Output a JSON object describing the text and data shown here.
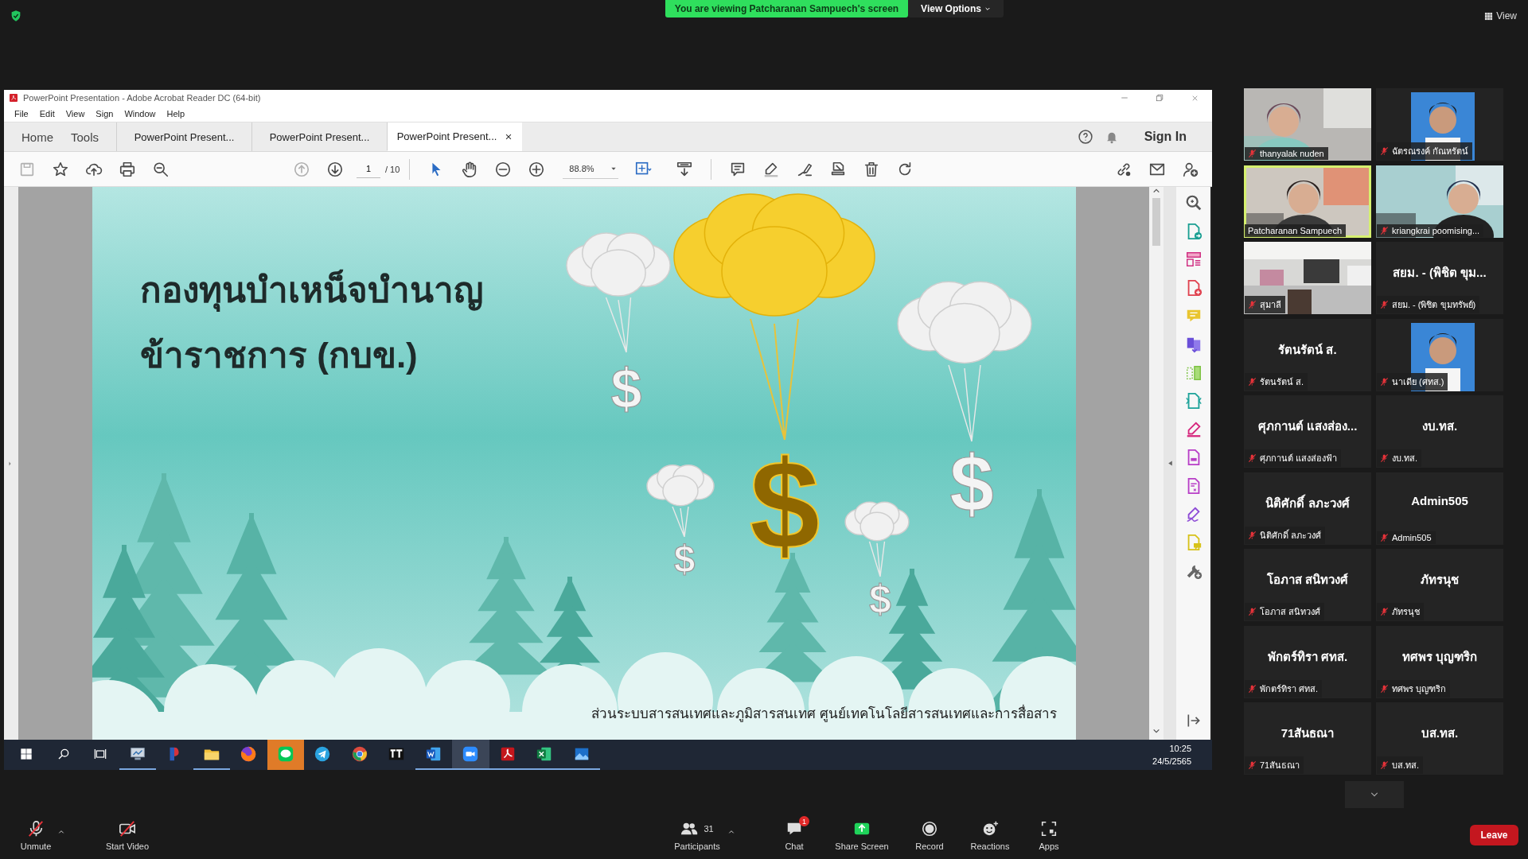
{
  "top_bar": {
    "banner": "You are viewing Patcharanan Sampuech's screen",
    "view_options": "View Options",
    "view": "View"
  },
  "shared_screen": {
    "title": "PowerPoint Presentation - Adobe Acrobat Reader DC (64-bit)",
    "menu": [
      "File",
      "Edit",
      "View",
      "Sign",
      "Window",
      "Help"
    ],
    "nav": [
      "Home",
      "Tools"
    ],
    "tabs": [
      {
        "label": "PowerPoint Present...",
        "selected": false
      },
      {
        "label": "PowerPoint Present...",
        "selected": false
      },
      {
        "label": "PowerPoint Present...",
        "selected": true
      }
    ],
    "sign_in": "Sign In",
    "toolbar": {
      "page": "1",
      "page_count": "/ 10",
      "zoom": "88.8%"
    },
    "slide": {
      "title": [
        "กองทุนบำเหน็จบำนาญ",
        "ข้าราชการ (กบข.)"
      ],
      "dollar_signs": [
        "$",
        "$",
        "$",
        "$",
        "$"
      ],
      "footer": "ส่วนระบบสารสนเทศและภูมิสารสนเทศ ศูนย์เทคโนโลยีสารสนเทศและการสื่อสาร"
    },
    "taskbar": {
      "apps": [
        {
          "open": true,
          "attention": false,
          "selected": false
        },
        {
          "open": false,
          "attention": false,
          "selected": false
        },
        {
          "open": true,
          "attention": false,
          "selected": false
        },
        {
          "open": false,
          "attention": false,
          "selected": false
        },
        {
          "open": false,
          "attention": true,
          "selected": false
        },
        {
          "open": false,
          "attention": false,
          "selected": false
        },
        {
          "open": false,
          "attention": false,
          "selected": false
        },
        {
          "open": false,
          "attention": false,
          "selected": false
        },
        {
          "open": true,
          "attention": false,
          "selected": false
        },
        {
          "open": true,
          "attention": false,
          "selected": true
        },
        {
          "open": true,
          "attention": false,
          "selected": false
        },
        {
          "open": true,
          "attention": false,
          "selected": false
        },
        {
          "open": true,
          "attention": false,
          "selected": false
        }
      ],
      "time": "10:25",
      "date": "24/5/2565"
    }
  },
  "participants": [
    {
      "label": "thanyalak nuden",
      "video": true,
      "muted": true,
      "active_speaker": false
    },
    {
      "label": "ฉัตรณรงค์ กัณหรัตน์",
      "video": true,
      "muted": true,
      "active_speaker": false
    },
    {
      "label": "Patcharanan Sampuech",
      "video": true,
      "muted": false,
      "active_speaker": true
    },
    {
      "label": "kriangkrai poomising...",
      "video": true,
      "muted": true,
      "active_speaker": false
    },
    {
      "label": "สุมาลี",
      "video": true,
      "muted": true,
      "active_speaker": false
    },
    {
      "display": "สยม. - (พิชิต ขุม...",
      "label": "สยม. - (พิชิต ขุมทรัพย์)",
      "video": false,
      "muted": true,
      "active_speaker": false
    },
    {
      "display": "รัตนรัตน์ ส.",
      "label": "รัตนรัตน์ ส.",
      "video": false,
      "muted": true,
      "active_speaker": false
    },
    {
      "label": "นาเดีย (ศทส.)",
      "video": true,
      "muted": true,
      "active_speaker": false
    },
    {
      "display": "ศุภกานต์ แสงส่อง...",
      "label": "ศุภกานต์ แสงส่องฟ้า",
      "video": false,
      "muted": true,
      "active_speaker": false
    },
    {
      "display": "งบ.ทส.",
      "label": "งบ.ทส.",
      "video": false,
      "muted": true,
      "active_speaker": false
    },
    {
      "display": "นิติศักดิ์ ลภะวงศ์",
      "label": "นิติศักดิ์ ลภะวงศ์",
      "video": false,
      "muted": true,
      "active_speaker": false
    },
    {
      "display": "Admin505",
      "label": "Admin505",
      "video": false,
      "muted": true,
      "active_speaker": false
    },
    {
      "display": "โอภาส สนิทวงศ์",
      "label": "โอภาส สนิทวงศ์",
      "video": false,
      "muted": true,
      "active_speaker": false
    },
    {
      "display": "ภัทรนุช",
      "label": "ภัทรนุช",
      "video": false,
      "muted": true,
      "active_speaker": false
    },
    {
      "display": "พักตร์ทิรา ศทส.",
      "label": "พักตร์ทิรา ศทส.",
      "video": false,
      "muted": true,
      "active_speaker": false
    },
    {
      "display": "ทศพร บุญฑริก",
      "label": "ทศพร บุญฑริก",
      "video": false,
      "muted": true,
      "active_speaker": false
    },
    {
      "display": "71สันธณา",
      "label": "71สันธณา",
      "video": false,
      "muted": true,
      "active_speaker": false
    },
    {
      "display": "บส.ทส.",
      "label": "บส.ทส.",
      "video": false,
      "muted": true,
      "active_speaker": false
    }
  ],
  "controls": [
    {
      "kind": "mic",
      "label": "Unmute"
    },
    {
      "kind": "video",
      "label": "Start Video"
    },
    {
      "kind": "participants",
      "label": "Participants",
      "count": "31"
    },
    {
      "kind": "chat",
      "label": "Chat",
      "badge": "1"
    },
    {
      "kind": "share",
      "label": "Share Screen"
    },
    {
      "kind": "record",
      "label": "Record"
    },
    {
      "kind": "reactions",
      "label": "Reactions"
    },
    {
      "kind": "apps",
      "label": "Apps"
    }
  ],
  "leave": "Leave"
}
